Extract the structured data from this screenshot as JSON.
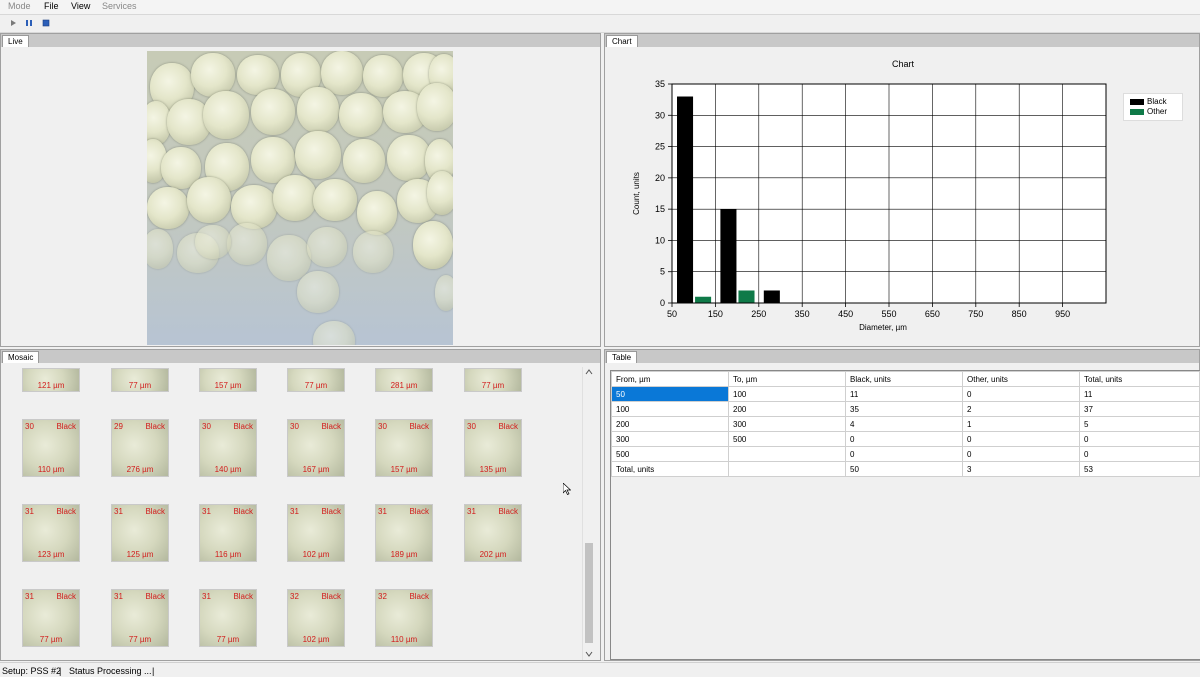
{
  "menu": {
    "mode": "Mode",
    "file": "File",
    "view": "View",
    "services": "Services"
  },
  "toolbar": {
    "play": "play-icon",
    "pause": "pause-icon",
    "stop": "stop-icon"
  },
  "panels": {
    "live": "Live",
    "chart": "Chart",
    "mosaic": "Mosaic",
    "table": "Table"
  },
  "colors": {
    "black_series": "#000000",
    "other_series": "#0f7a48",
    "selected": "#0a78d7",
    "thumb_text": "#d21a1a"
  },
  "chart_data": {
    "type": "bar",
    "title": "Chart",
    "xlabel": "Diameter, µm",
    "ylabel": "Count, units",
    "categories": [
      "50–150",
      "150–250",
      "250–350"
    ],
    "x_ticks": [
      "50",
      "150",
      "250",
      "350",
      "450",
      "550",
      "650",
      "750",
      "850",
      "950"
    ],
    "y_ticks": [
      "0",
      "5",
      "10",
      "15",
      "20",
      "25",
      "30",
      "35"
    ],
    "ylim": [
      0,
      35
    ],
    "xlim": [
      50,
      1050
    ],
    "grid": true,
    "legend_position": "top-right",
    "series": [
      {
        "name": "Black",
        "color": "#000000",
        "values": [
          33,
          15,
          2
        ]
      },
      {
        "name": "Other",
        "color": "#0f7a48",
        "values": [
          1,
          2,
          0
        ]
      }
    ]
  },
  "table": {
    "headers": [
      "From, µm",
      "To, µm",
      "Black, units",
      "Other, units",
      "Total, units"
    ],
    "rows": [
      [
        "50",
        "100",
        "11",
        "0",
        "11"
      ],
      [
        "100",
        "200",
        "35",
        "2",
        "37"
      ],
      [
        "200",
        "300",
        "4",
        "1",
        "5"
      ],
      [
        "300",
        "500",
        "0",
        "0",
        "0"
      ],
      [
        "500",
        "",
        "0",
        "0",
        "0"
      ],
      [
        "Total, units",
        "",
        "50",
        "3",
        "53"
      ]
    ]
  },
  "mosaic": {
    "partial_row": [
      "121 µm",
      "77 µm",
      "157 µm",
      "77 µm",
      "281 µm",
      "77 µm"
    ],
    "rows": [
      [
        {
          "id": "30",
          "cls": "Black",
          "size": "110 µm"
        },
        {
          "id": "29",
          "cls": "Black",
          "size": "276 µm"
        },
        {
          "id": "30",
          "cls": "Black",
          "size": "140 µm"
        },
        {
          "id": "30",
          "cls": "Black",
          "size": "167 µm"
        },
        {
          "id": "30",
          "cls": "Black",
          "size": "157 µm"
        },
        {
          "id": "30",
          "cls": "Black",
          "size": "135 µm"
        }
      ],
      [
        {
          "id": "31",
          "cls": "Black",
          "size": "123 µm"
        },
        {
          "id": "31",
          "cls": "Black",
          "size": "125 µm"
        },
        {
          "id": "31",
          "cls": "Black",
          "size": "116 µm"
        },
        {
          "id": "31",
          "cls": "Black",
          "size": "102 µm"
        },
        {
          "id": "31",
          "cls": "Black",
          "size": "189 µm"
        },
        {
          "id": "31",
          "cls": "Black",
          "size": "202 µm"
        }
      ],
      [
        {
          "id": "31",
          "cls": "Black",
          "size": "77 µm"
        },
        {
          "id": "31",
          "cls": "Black",
          "size": "77 µm"
        },
        {
          "id": "31",
          "cls": "Black",
          "size": "77 µm"
        },
        {
          "id": "32",
          "cls": "Black",
          "size": "102 µm"
        },
        {
          "id": "32",
          "cls": "Black",
          "size": "110 µm"
        }
      ]
    ]
  },
  "status": {
    "setup": "Setup: PSS #2",
    "sep1": "|",
    "status": "Status  Processing ...",
    "sep2": "|"
  }
}
